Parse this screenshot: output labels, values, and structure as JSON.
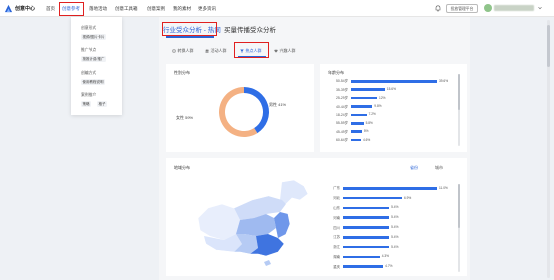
{
  "header": {
    "logo_text": "创意中心",
    "nav": [
      "首页",
      "创意参考",
      "落地活动",
      "创意工具箱",
      "创意案例",
      "我的素材",
      "更多资讯"
    ],
    "help_label": "投放管理平台"
  },
  "dropdown": {
    "sections": [
      {
        "title": "创意形式",
        "chips": [
          "视频/图片卡片"
        ]
      },
      {
        "title": "推广节点",
        "chips": [
          "按推计费/推广"
        ]
      },
      {
        "title": "创编方式",
        "chips": [
          "使用教程说明"
        ]
      },
      {
        "title": "案例推介",
        "chips": [
          "策略",
          "格子"
        ]
      }
    ]
  },
  "tabs": {
    "main": "行业受众分析 - 热词",
    "second": "买量传播受众分析"
  },
  "sub_tabs": [
    "转换人群",
    "活动人群",
    "热点人群",
    "兴趣人群"
  ],
  "gender_panel": {
    "title": "性别分布",
    "male_label": "男性 41%",
    "female_label": "女性 59%"
  },
  "age_panel": {
    "title": "年龄分布"
  },
  "region_panel": {
    "title": "地域分布",
    "tab_province": "省份",
    "tab_city": "城市"
  },
  "colors": {
    "accent": "#2f6ee6",
    "female": "#f4b183",
    "highlight_box": "#e02020"
  },
  "chart_data": [
    {
      "type": "pie",
      "title": "性别分布",
      "categories": [
        "男性",
        "女性"
      ],
      "values": [
        41,
        59
      ]
    },
    {
      "type": "bar",
      "title": "年龄分布",
      "categories": [
        "50-54岁",
        "35-39岁",
        "25-29岁",
        "40-44岁",
        "18-24岁",
        "55-59岁",
        "45-49岁",
        "60-64岁"
      ],
      "values": [
        39.6,
        15.6,
        12.0,
        9.8,
        7.2,
        5.8,
        5.0,
        4.6
      ],
      "labels": [
        "39.6%",
        "15.6%",
        "12%",
        "9.8%",
        "7.2%",
        "5.8%",
        "5%",
        "4.6%"
      ]
    },
    {
      "type": "bar",
      "title": "地域分布",
      "categories": [
        "广东",
        "河北",
        "山东",
        "河南",
        "四川",
        "江苏",
        "浙江",
        "湖南",
        "重庆"
      ],
      "values": [
        11.0,
        6.9,
        5.4,
        5.4,
        5.4,
        5.4,
        5.4,
        4.3,
        4.7
      ],
      "labels": [
        "11.0%",
        "6.9%",
        "5.4%",
        "5.4%",
        "5.4%",
        "5.4%",
        "5.4%",
        "4.3%",
        "4.7%"
      ]
    }
  ]
}
